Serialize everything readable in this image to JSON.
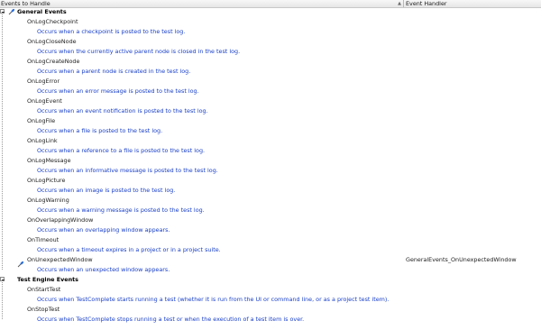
{
  "header": {
    "events_column": "Events to Handle",
    "handler_column": "Event Handler"
  },
  "categories": [
    {
      "name": "General Events",
      "events": [
        {
          "name": "OnLogCheckpoint",
          "description": "Occurs when a checkpoint is posted to the test log.",
          "handler": ""
        },
        {
          "name": "OnLogCloseNode",
          "description": "Occurs when the currently active parent node is closed in the test log.",
          "handler": ""
        },
        {
          "name": "OnLogCreateNode",
          "description": "Occurs when a parent node is created in the test log.",
          "handler": ""
        },
        {
          "name": "OnLogError",
          "description": "Occurs when an error message is posted to the test log.",
          "handler": ""
        },
        {
          "name": "OnLogEvent",
          "description": "Occurs when an event notification is posted to the test log.",
          "handler": ""
        },
        {
          "name": "OnLogFile",
          "description": "Occurs when a file is posted to the test log.",
          "handler": ""
        },
        {
          "name": "OnLogLink",
          "description": "Occurs when a reference to a file is posted to the test log.",
          "handler": ""
        },
        {
          "name": "OnLogMessage",
          "description": "Occurs when an informative message is posted to the test log.",
          "handler": ""
        },
        {
          "name": "OnLogPicture",
          "description": "Occurs when an image is posted to the test log.",
          "handler": ""
        },
        {
          "name": "OnLogWarning",
          "description": "Occurs when a warning message is posted to the test log.",
          "handler": ""
        },
        {
          "name": "OnOverlappingWindow",
          "description": "Occurs when an overlapping window appears.",
          "handler": ""
        },
        {
          "name": "OnTimeout",
          "description": "Occurs when a timeout expires in a project or in a project suite.",
          "handler": ""
        },
        {
          "name": "OnUnexpectedWindow",
          "description": "Occurs when an unexpected window appears.",
          "handler": "GeneralEvents_OnUnexpectedWindow"
        }
      ]
    },
    {
      "name": "Test Engine Events",
      "events": [
        {
          "name": "OnStartTest",
          "description": "Occurs when TestComplete starts running a test (whether it is run from the UI or command line, or as a project test item).",
          "handler": ""
        },
        {
          "name": "OnStopTest",
          "description": "Occurs when TestComplete stops running a test or when the execution of a test item is over.",
          "handler": ""
        }
      ]
    }
  ],
  "icons": {
    "collapse": "minus-box-icon",
    "pin": "pushpin-icon"
  },
  "colors": {
    "description": "#1a40c8",
    "pin": "#2f6fd6"
  }
}
